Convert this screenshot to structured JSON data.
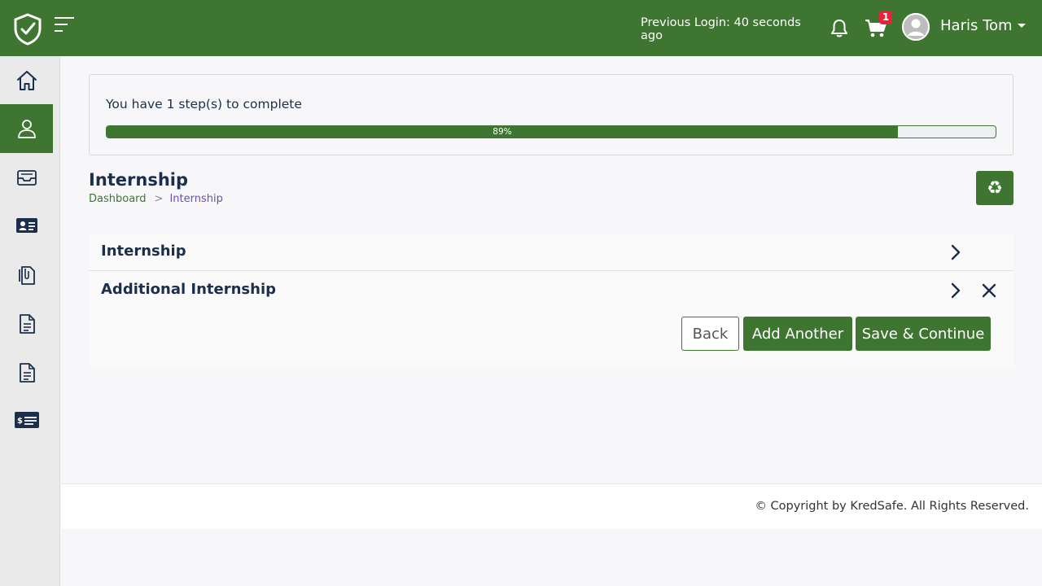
{
  "header": {
    "previous_login": "Previous Login: 40 seconds ago",
    "cart_count": "1",
    "user_name": "Haris Tom",
    "brand_color": "#3e7631",
    "badge_color": "#e5233b"
  },
  "sidebar": {
    "items": [
      {
        "icon": "home-icon",
        "active": false
      },
      {
        "icon": "user-icon",
        "active": true
      },
      {
        "icon": "inbox-tray-icon",
        "active": false
      },
      {
        "icon": "id-card-icon",
        "active": false
      },
      {
        "icon": "documents-icon",
        "active": false
      },
      {
        "icon": "document-icon",
        "active": false
      },
      {
        "icon": "document-icon",
        "active": false
      },
      {
        "icon": "payment-card-icon",
        "active": false
      }
    ]
  },
  "progress": {
    "text": "You have 1 step(s) to complete",
    "percent": 89,
    "percent_label": "89%"
  },
  "page": {
    "title": "Internship",
    "breadcrumb": {
      "home": "Dashboard",
      "separator": ">",
      "current": "Internship"
    }
  },
  "sections": [
    {
      "label": "Internship"
    },
    {
      "label": "Additional Internship"
    }
  ],
  "actions": {
    "back": "Back",
    "add_another": "Add Another",
    "save_continue": "Save & Continue"
  },
  "footer": {
    "copyright": "© Copyright by KredSafe. All Rights Reserved."
  }
}
